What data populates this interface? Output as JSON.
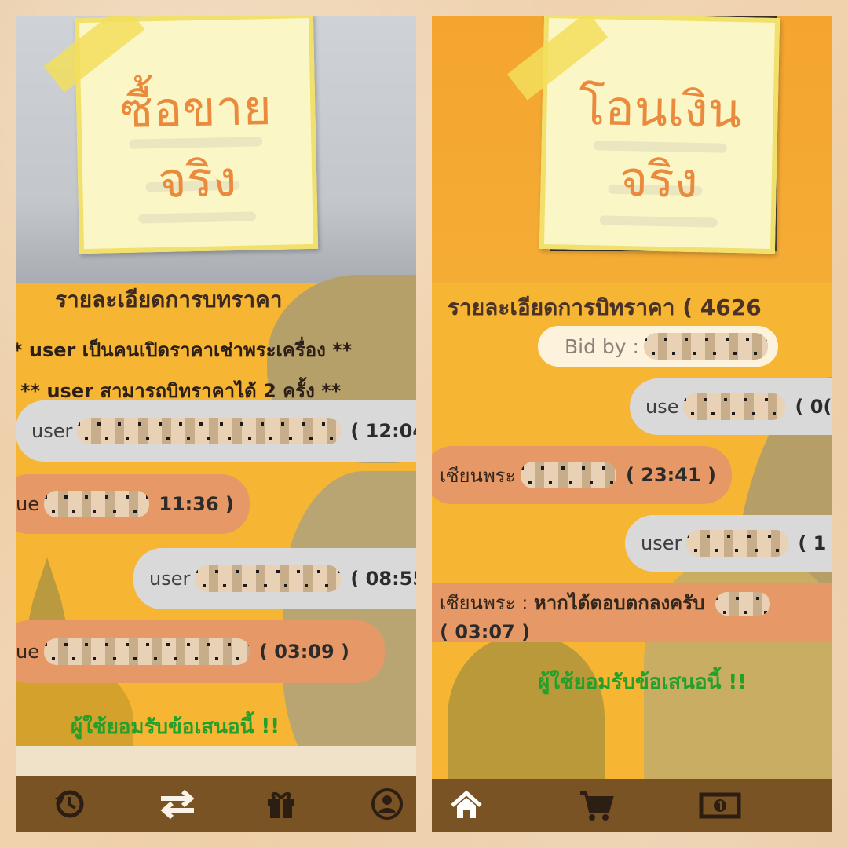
{
  "left_panel": {
    "note": {
      "line1": "ซื้อขาย",
      "line2": "จริง"
    },
    "heading": "รายละเอียดการบทราคา",
    "rule1": "* user เป็นคนเปิดราคาเช่าพระเครื่อง **",
    "rule2": "** user สามารถบิทราคาได้ 2 ครั้ง **",
    "messages": [
      {
        "sender": "user",
        "time": "( 12:04"
      },
      {
        "sender": "ue",
        "time": "11:36 )"
      },
      {
        "sender": "user",
        "time": "( 08:55"
      },
      {
        "sender": "ue",
        "time": "( 03:09 )"
      }
    ],
    "accepted": "ผู้ใช้ยอมรับข้อเสนอนี้ !!",
    "nav": [
      "history-icon",
      "swap-icon",
      "gift-icon",
      "user-icon"
    ]
  },
  "right_panel": {
    "note": {
      "line1": "โอนเงิน",
      "line2": "จริง"
    },
    "heading": "รายละเอียดการบิทราคา  ( 4626",
    "bid_by": "Bid by :",
    "messages": [
      {
        "sender": "use",
        "time": "( 0("
      },
      {
        "sender": "เซียนพระ",
        "time": "( 23:41 )"
      },
      {
        "sender": "user",
        "time": "( 1"
      },
      {
        "sender": "เซียนพระ :",
        "text": "หากได้ตอบตกลงครับ",
        "time": "( 03:07 )"
      }
    ],
    "accepted": "ผู้ใช้ยอมรับข้อเสนอนี้ !!",
    "nav": [
      "home-icon",
      "cart-icon",
      "money-icon"
    ]
  },
  "colors": {
    "panel_bg": "#f6b533",
    "grey_bubble": "#d9d9da",
    "salmon_bubble": "#e69967",
    "nav_bar": "#7a5324",
    "accept_green": "#22a02a",
    "note_text": "#ea8a3c"
  }
}
